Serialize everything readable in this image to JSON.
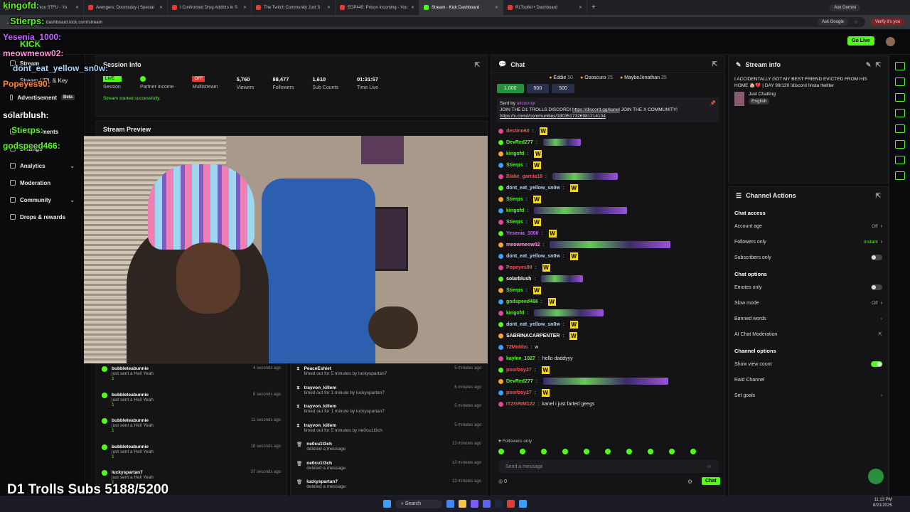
{
  "browser": {
    "tabs": [
      {
        "label": "(1) Drake - Janice STFU - Yo"
      },
      {
        "label": "Avengers: Doomsday | Special"
      },
      {
        "label": "I Confronted Drug Addicts In S"
      },
      {
        "label": "The Twitch Community Just S"
      },
      {
        "label": "EDP445: Prison Incoming - You"
      },
      {
        "label": "Stream - Kick Dashboard"
      },
      {
        "label": "RLToolkit • Dashboard"
      }
    ],
    "ask_gemini": "Ask Gemini",
    "url": "dashboard.kick.com/stream",
    "ask_google": "Ask Google",
    "verify": "Verify it's you"
  },
  "topnav": {
    "go_live": "Go Live",
    "brand": "KICK"
  },
  "sidebar": {
    "items": [
      {
        "label": "Stream"
      },
      {
        "label": "Stream URL & Key"
      },
      {
        "label": "Advertisement",
        "badge": "Beta"
      },
      {
        "label": "Revenue"
      },
      {
        "label": "Achievements"
      },
      {
        "label": "Settings"
      },
      {
        "label": "Analytics"
      },
      {
        "label": "Moderation"
      },
      {
        "label": "Community"
      },
      {
        "label": "Drops & rewards"
      }
    ]
  },
  "session": {
    "title": "Session Info",
    "live_badge": "LIVE",
    "off_badge": "OFF",
    "labels": [
      "Session",
      "Partner income",
      "Multistream",
      "Viewers",
      "Followers",
      "Sub Counts",
      "Time Live"
    ],
    "viewers": "5,760",
    "followers": "88,477",
    "subs": "1,610",
    "time_live": "01:31:57",
    "status": "Stream started successfully."
  },
  "preview": {
    "title": "Stream Preview"
  },
  "feed_left": [
    {
      "name": "bubbleteabunnie",
      "action": "just sent a Heil Yeah",
      "count": "1",
      "time": "4 seconds ago"
    },
    {
      "name": "bubbleteabunnie",
      "action": "just sent a Heil Yeah",
      "count": "1",
      "time": "8 seconds ago"
    },
    {
      "name": "bubbleteabunnie",
      "action": "just sent a Heil Yeah",
      "count": "1",
      "time": "11 seconds ago"
    },
    {
      "name": "bubbleteabunnie",
      "action": "just sent a Heil Yeah",
      "count": "1",
      "time": "18 seconds ago"
    },
    {
      "name": "luckyspartan7",
      "action": "just sent a Heil Yeah",
      "count": "1",
      "time": "37 seconds ago"
    }
  ],
  "feed_right": [
    {
      "name": "PeaceEshiet",
      "action": "timed out for 5 minutes by luckyspartan7",
      "time": "5 minutes ago"
    },
    {
      "name": "trayvon_killem",
      "action": "timed out for 1 minute by luckyspartan7",
      "time": "6 minutes ago"
    },
    {
      "name": "trayvon_killem",
      "action": "timed out for 1 minute by luckyspartan7",
      "time": "5 minutes ago"
    },
    {
      "name": "trayvon_killem",
      "action": "timed out for 5 minutes by ne0cu1t3ch",
      "time": "5 minutes ago"
    },
    {
      "name": "ne0cu1t3ch",
      "action": "deleted a message",
      "time": "13 minutes ago"
    },
    {
      "name": "ne0cu1t3ch",
      "action": "deleted a message",
      "time": "13 minutes ago"
    },
    {
      "name": "luckyspartan7",
      "action": "deleted a message",
      "time": "13 minutes ago"
    }
  ],
  "chat": {
    "title": "Chat",
    "top": [
      {
        "name": "Eddie",
        "count": "50"
      },
      {
        "name": "Ososcuro",
        "count": "25"
      },
      {
        "name": "MaybeJonathan",
        "count": "25"
      }
    ],
    "gift_buttons": [
      "1,000",
      "500",
      "500"
    ],
    "pinned_by": "Sent by",
    "pinned_user": "alicixxnjx",
    "pinned_text": "JOIN THE D1 TROLLS DISCORD!",
    "pinned_link1": "https://discord.gg/kanel",
    "pinned_text2": "JOIN THE X COMMUNITY!",
    "pinned_link2": "https://x.com/i/communities/1803517326981214104",
    "messages": [
      {
        "user": "destino60",
        "color": "#ff4d4d",
        "text": ""
      },
      {
        "user": "DevRed277",
        "color": "#53fc18",
        "text": ""
      },
      {
        "user": "kingofd",
        "color": "#53fc18",
        "text": ""
      },
      {
        "user": "Stierps",
        "color": "#53fc18",
        "text": ""
      },
      {
        "user": "Blake_garcia18",
        "color": "#ff4d4d",
        "text": ""
      },
      {
        "user": "dont_eat_yellow_sn0w",
        "color": "#a9d4ff",
        "text": ""
      },
      {
        "user": "Stierps",
        "color": "#53fc18",
        "text": ""
      },
      {
        "user": "kingofd",
        "color": "#53fc18",
        "text": ""
      },
      {
        "user": "Stierps",
        "color": "#53fc18",
        "text": ""
      },
      {
        "user": "Yesenia_1000",
        "color": "#c463ff",
        "text": ""
      },
      {
        "user": "meowmeow02",
        "color": "#ff99dd",
        "text": ""
      },
      {
        "user": "dont_eat_yellow_sn0w",
        "color": "#a9d4ff",
        "text": ""
      },
      {
        "user": "Popeyes90",
        "color": "#ff4d4d",
        "text": ""
      },
      {
        "user": "solarblush",
        "color": "#ffffff",
        "text": ""
      },
      {
        "user": "Stierps",
        "color": "#53fc18",
        "text": ""
      },
      {
        "user": "godspeed466",
        "color": "#53fc18",
        "text": ""
      },
      {
        "user": "kingofd",
        "color": "#53fc18",
        "text": ""
      },
      {
        "user": "dont_eat_yellow_sn0w",
        "color": "#a9d4ff",
        "text": ""
      },
      {
        "user": "SABRINACARPENTER",
        "color": "#ffffff",
        "text": ""
      },
      {
        "user": "72Mobbs",
        "color": "#ff4d4d",
        "text": "w"
      },
      {
        "user": "kaylee_1027",
        "color": "#53fc18",
        "text": "hello daddyyy"
      },
      {
        "user": "poorboy27",
        "color": "#ff4d4d",
        "text": ""
      },
      {
        "user": "DevRed277",
        "color": "#53fc18",
        "text": ""
      },
      {
        "user": "poorboy27",
        "color": "#ff4d4d",
        "text": ""
      },
      {
        "user": "ITZGRIM122",
        "color": "#ff4d4d",
        "text": "kanel i just farted geegs"
      }
    ],
    "followers_only": "Followers only",
    "send_placeholder": "Send a message",
    "chat_button": "Chat",
    "points": "0"
  },
  "stream_info": {
    "title": "Stream info",
    "stream_title": "I ACCIDENTALLY GOT MY BEST FRIEND EVICTED FROM HIS HOME 🏠💔 | DAY 99/120 !discord !insta !twitter",
    "category": "Just Chatting",
    "language": "English"
  },
  "channel_actions": {
    "title": "Channel Actions",
    "sections": {
      "chat_access": "Chat access",
      "chat_options": "Chat options",
      "channel_options": "Channel options"
    },
    "account_age": {
      "label": "Account age",
      "value": "Off"
    },
    "followers_only": {
      "label": "Followers only",
      "value": "Instant"
    },
    "subscribers_only": {
      "label": "Subscribers only"
    },
    "emotes_only": {
      "label": "Emotes only"
    },
    "slow_mode": {
      "label": "Slow mode",
      "value": "Off"
    },
    "banned_words": {
      "label": "Banned words"
    },
    "ai_mod": {
      "label": "AI Chat Moderation"
    },
    "show_view_count": {
      "label": "Show view count"
    },
    "raid_channel": {
      "label": "Raid Channel"
    },
    "set_goals": {
      "label": "Set goals"
    }
  },
  "overlay": {
    "goal": "D1 Trolls Subs 5188/5200",
    "names": [
      "kingofd:",
      "Stierps:",
      "Yesenia_1000:",
      "meowmeow02:",
      "dont_eat_yellow_sn0w:",
      "Popeyes90:",
      "solarblush:",
      "Stierps:",
      "godspeed466:"
    ]
  },
  "taskbar": {
    "search": "Search",
    "time": "11:13 PM",
    "date": "8/21/2025"
  }
}
